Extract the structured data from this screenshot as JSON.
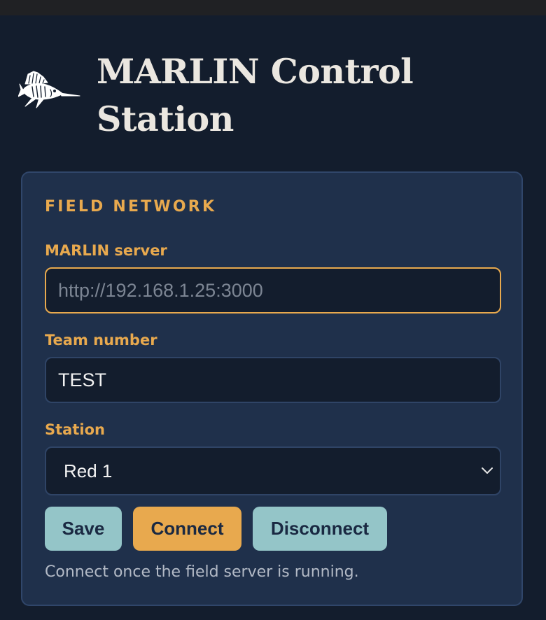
{
  "app": {
    "title": "MARLIN Control Station",
    "logo_icon": "marlin-fish-icon"
  },
  "colors": {
    "background": "#131d2d",
    "panel": "#1f304b",
    "accent": "#e8a94e",
    "secondary_button": "#94c5c8",
    "input_background": "#131d2d"
  },
  "panel": {
    "title": "FIELD NETWORK",
    "server": {
      "label": "MARLIN server",
      "value": "",
      "placeholder": "http://192.168.1.25:3000"
    },
    "team": {
      "label": "Team number",
      "value": "TEST"
    },
    "station": {
      "label": "Station",
      "value": "Red 1",
      "icon": "chevron-down-icon"
    },
    "buttons": {
      "save": "Save",
      "connect": "Connect",
      "disconnect": "Disconnect"
    },
    "hint": "Connect once the field server is running."
  }
}
